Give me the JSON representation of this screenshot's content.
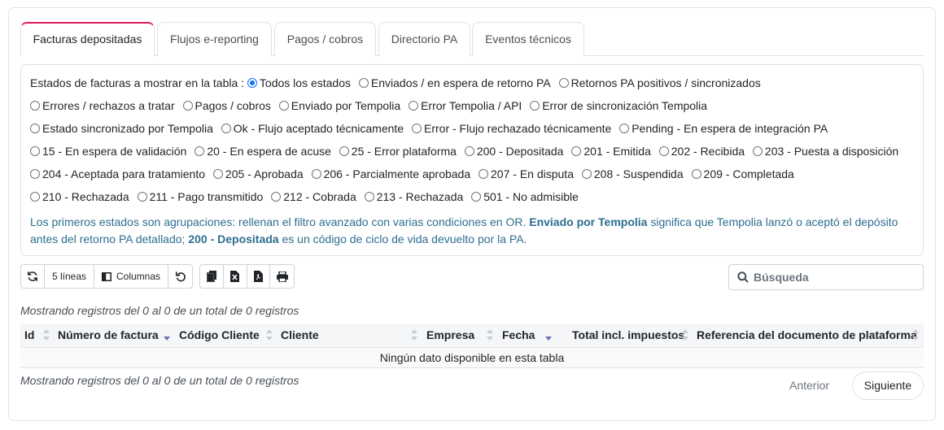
{
  "tabs": [
    {
      "label": "Facturas depositadas"
    },
    {
      "label": "Flujos e-reporting"
    },
    {
      "label": "Pagos / cobros"
    },
    {
      "label": "Directorio PA"
    },
    {
      "label": "Eventos técnicos"
    }
  ],
  "filter": {
    "label": "Estados de facturas a mostrar en la tabla :",
    "options": [
      "Todos los estados",
      "Enviados / en espera de retorno PA",
      "Retornos PA positivos / sincronizados",
      "Errores / rechazos a tratar",
      "Pagos / cobros",
      "Enviado por Tempolia",
      "Error Tempolia / API",
      "Error de sincronización Tempolia",
      "Estado sincronizado por Tempolia",
      "Ok - Flujo aceptado técnicamente",
      "Error - Flujo rechazado técnicamente",
      "Pending - En espera de integración PA",
      "15 - En espera de validación",
      "20 - En espera de acuse",
      "25 - Error plataforma",
      "200 - Depositada",
      "201 - Emitida",
      "202 - Recibida",
      "203 - Puesta a disposición",
      "204 - Aceptada para tratamiento",
      "205 - Aprobada",
      "206 - Parcialmente aprobada",
      "207 - En disputa",
      "208 - Suspendida",
      "209 - Completada",
      "210 - Rechazada",
      "211 - Pago transmitido",
      "212 - Cobrada",
      "213 - Rechazada",
      "501 - No admisible"
    ],
    "hint": {
      "p1": "Los primeros estados son agrupaciones: rellenan el filtro avanzado con varias condiciones en OR. ",
      "b1": "Enviado por Tempolia",
      "p2": " significa que Tempolia lanzó o aceptó el depósito antes del retorno PA detallado; ",
      "b2": "200 - Depositada",
      "p3": " es un código de ciclo de vida devuelto por la PA."
    }
  },
  "toolbar": {
    "lines_label": "5 líneas",
    "columns_label": "Columnas"
  },
  "search": {
    "placeholder": "Búsqueda"
  },
  "table": {
    "info_top": "Mostrando registros del 0 al 0 de un total de 0 registros",
    "info_bottom": "Mostrando registros del 0 al 0 de un total de 0 registros",
    "headers": [
      "Id",
      "Número de factura",
      "Código Cliente",
      "Cliente",
      "Empresa",
      "Fecha",
      "Total incl. impuestos",
      "Referencia del documento de plataforma"
    ],
    "empty": "Ningún dato disponible en esta tabla"
  },
  "pager": {
    "prev": "Anterior",
    "next": "Siguiente"
  },
  "colors": {
    "accent": "#d81b60",
    "radio": "#0d6efd",
    "hint": "#2c6e8f"
  }
}
